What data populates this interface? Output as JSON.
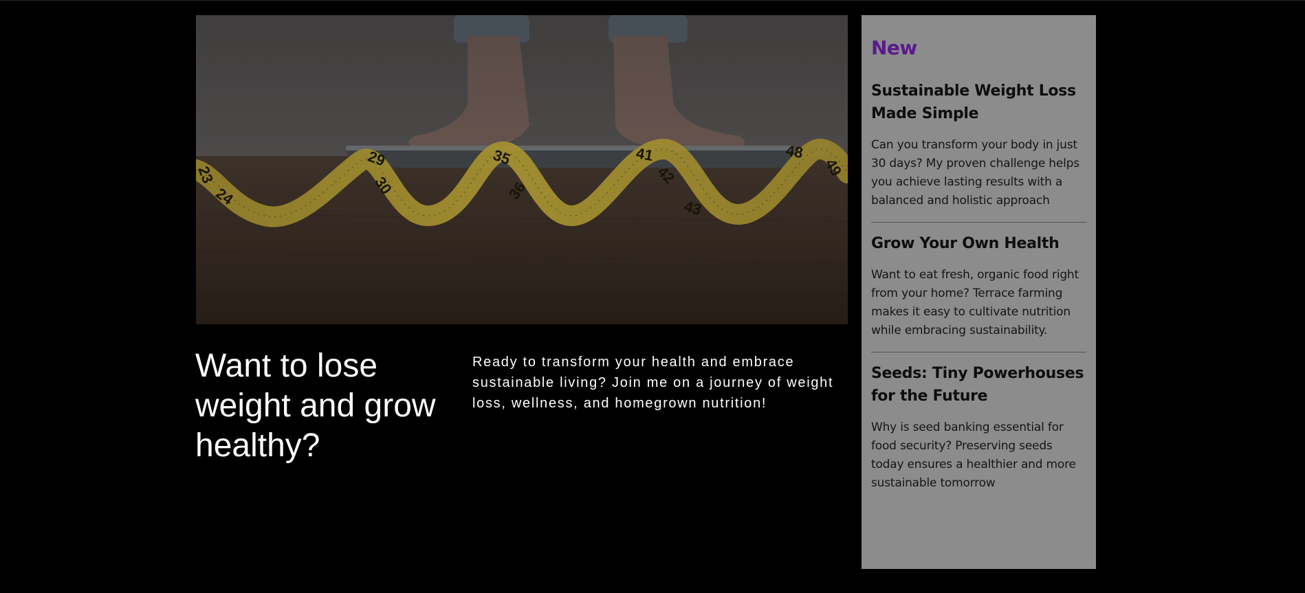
{
  "hero": {
    "tape_numbers": [
      "23",
      "24",
      "29",
      "30",
      "35",
      "36",
      "41",
      "42",
      "43",
      "48",
      "49"
    ]
  },
  "headline": "Want to lose weight and grow healthy?",
  "intro": "Ready to transform your health and embrace sustainable living? Join me on a journey of weight loss, wellness, and homegrown nutrition!",
  "sidebar": {
    "heading": "New",
    "articles": [
      {
        "title": "Sustainable Weight Loss Made Simple",
        "text": "Can you transform your body in just 30 days? My proven challenge helps you achieve lasting results with a balanced and holistic approach"
      },
      {
        "title": "Grow Your Own Health",
        "text": "Want to eat fresh, organic food right from your home? Terrace farming makes it easy to cultivate nutrition while embracing sustainability."
      },
      {
        "title": "Seeds: Tiny Powerhouses for the Future",
        "text": "Why is seed banking essential for food security? Preserving seeds today ensures a healthier and more sustainable tomorrow"
      }
    ]
  },
  "colors": {
    "background": "#000000",
    "sidebar": "#8c8c8c",
    "accent": "#5a1a8c",
    "tape": "#c9b13a"
  }
}
